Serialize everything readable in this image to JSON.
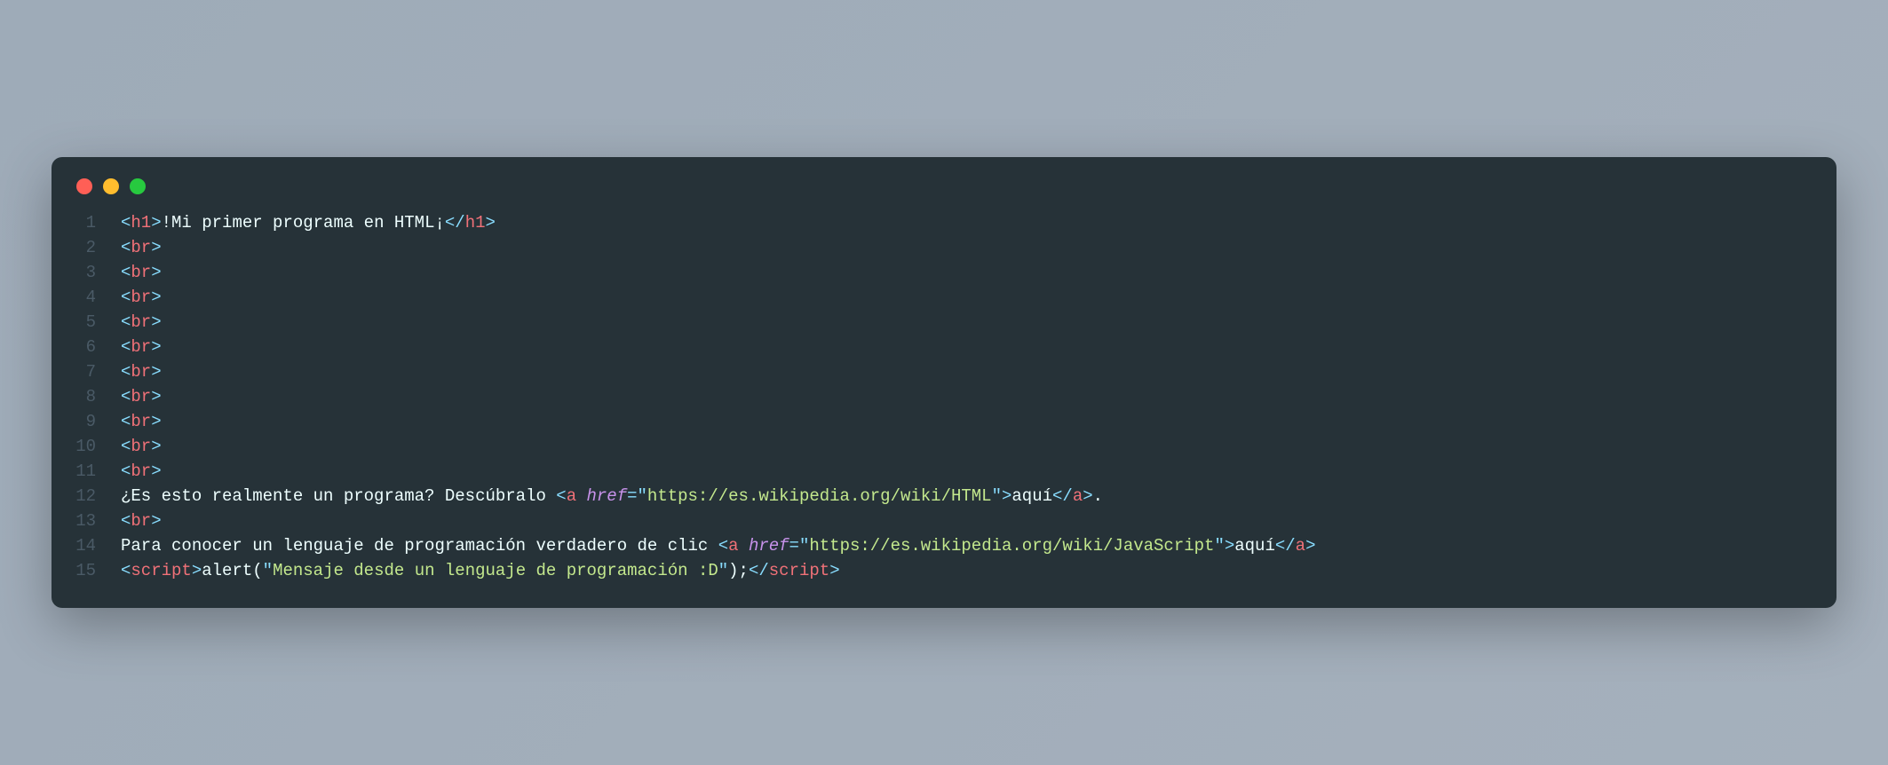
{
  "window": {
    "buttons": [
      "close",
      "minimize",
      "maximize"
    ]
  },
  "code": {
    "lines": [
      {
        "num": "1",
        "tokens": [
          {
            "t": "punct",
            "v": "<"
          },
          {
            "t": "tag",
            "v": "h1"
          },
          {
            "t": "punct",
            "v": ">"
          },
          {
            "t": "text",
            "v": "!Mi primer programa en HTML¡"
          },
          {
            "t": "punct",
            "v": "</"
          },
          {
            "t": "tag",
            "v": "h1"
          },
          {
            "t": "punct",
            "v": ">"
          }
        ]
      },
      {
        "num": "2",
        "tokens": [
          {
            "t": "punct",
            "v": "<"
          },
          {
            "t": "tag",
            "v": "br"
          },
          {
            "t": "punct",
            "v": ">"
          }
        ]
      },
      {
        "num": "3",
        "tokens": [
          {
            "t": "punct",
            "v": "<"
          },
          {
            "t": "tag",
            "v": "br"
          },
          {
            "t": "punct",
            "v": ">"
          }
        ]
      },
      {
        "num": "4",
        "tokens": [
          {
            "t": "punct",
            "v": "<"
          },
          {
            "t": "tag",
            "v": "br"
          },
          {
            "t": "punct",
            "v": ">"
          }
        ]
      },
      {
        "num": "5",
        "tokens": [
          {
            "t": "punct",
            "v": "<"
          },
          {
            "t": "tag",
            "v": "br"
          },
          {
            "t": "punct",
            "v": ">"
          }
        ]
      },
      {
        "num": "6",
        "tokens": [
          {
            "t": "punct",
            "v": "<"
          },
          {
            "t": "tag",
            "v": "br"
          },
          {
            "t": "punct",
            "v": ">"
          }
        ]
      },
      {
        "num": "7",
        "tokens": [
          {
            "t": "punct",
            "v": "<"
          },
          {
            "t": "tag",
            "v": "br"
          },
          {
            "t": "punct",
            "v": ">"
          }
        ]
      },
      {
        "num": "8",
        "tokens": [
          {
            "t": "punct",
            "v": "<"
          },
          {
            "t": "tag",
            "v": "br"
          },
          {
            "t": "punct",
            "v": ">"
          }
        ]
      },
      {
        "num": "9",
        "tokens": [
          {
            "t": "punct",
            "v": "<"
          },
          {
            "t": "tag",
            "v": "br"
          },
          {
            "t": "punct",
            "v": ">"
          }
        ]
      },
      {
        "num": "10",
        "tokens": [
          {
            "t": "punct",
            "v": "<"
          },
          {
            "t": "tag",
            "v": "br"
          },
          {
            "t": "punct",
            "v": ">"
          }
        ]
      },
      {
        "num": "11",
        "tokens": [
          {
            "t": "punct",
            "v": "<"
          },
          {
            "t": "tag",
            "v": "br"
          },
          {
            "t": "punct",
            "v": ">"
          }
        ]
      },
      {
        "num": "12",
        "tokens": [
          {
            "t": "text",
            "v": "¿Es esto realmente un programa? Descúbralo "
          },
          {
            "t": "punct",
            "v": "<"
          },
          {
            "t": "tag",
            "v": "a"
          },
          {
            "t": "text",
            "v": " "
          },
          {
            "t": "attr",
            "v": "href"
          },
          {
            "t": "op",
            "v": "="
          },
          {
            "t": "punct",
            "v": "\""
          },
          {
            "t": "string",
            "v": "https://es.wikipedia.org/wiki/HTML"
          },
          {
            "t": "punct",
            "v": "\""
          },
          {
            "t": "punct",
            "v": ">"
          },
          {
            "t": "text",
            "v": "aquí"
          },
          {
            "t": "punct",
            "v": "</"
          },
          {
            "t": "tag",
            "v": "a"
          },
          {
            "t": "punct",
            "v": ">"
          },
          {
            "t": "text",
            "v": "."
          }
        ]
      },
      {
        "num": "13",
        "tokens": [
          {
            "t": "punct",
            "v": "<"
          },
          {
            "t": "tag",
            "v": "br"
          },
          {
            "t": "punct",
            "v": ">"
          }
        ]
      },
      {
        "num": "14",
        "tokens": [
          {
            "t": "text",
            "v": "Para conocer un lenguaje de programación verdadero de clic "
          },
          {
            "t": "punct",
            "v": "<"
          },
          {
            "t": "tag",
            "v": "a"
          },
          {
            "t": "text",
            "v": " "
          },
          {
            "t": "attr",
            "v": "href"
          },
          {
            "t": "op",
            "v": "="
          },
          {
            "t": "punct",
            "v": "\""
          },
          {
            "t": "string",
            "v": "https://es.wikipedia.org/wiki/JavaScript"
          },
          {
            "t": "punct",
            "v": "\""
          },
          {
            "t": "punct",
            "v": ">"
          },
          {
            "t": "text",
            "v": "aquí"
          },
          {
            "t": "punct",
            "v": "</"
          },
          {
            "t": "tag",
            "v": "a"
          },
          {
            "t": "punct",
            "v": ">"
          }
        ]
      },
      {
        "num": "15",
        "tokens": [
          {
            "t": "punct",
            "v": "<"
          },
          {
            "t": "tag",
            "v": "script"
          },
          {
            "t": "punct",
            "v": ">"
          },
          {
            "t": "text",
            "v": "alert("
          },
          {
            "t": "punct",
            "v": "\""
          },
          {
            "t": "string",
            "v": "Mensaje desde un lenguaje de programación :D"
          },
          {
            "t": "punct",
            "v": "\""
          },
          {
            "t": "text",
            "v": ");"
          },
          {
            "t": "punct",
            "v": "</"
          },
          {
            "t": "tag",
            "v": "script"
          },
          {
            "t": "punct",
            "v": ">"
          }
        ]
      }
    ]
  }
}
